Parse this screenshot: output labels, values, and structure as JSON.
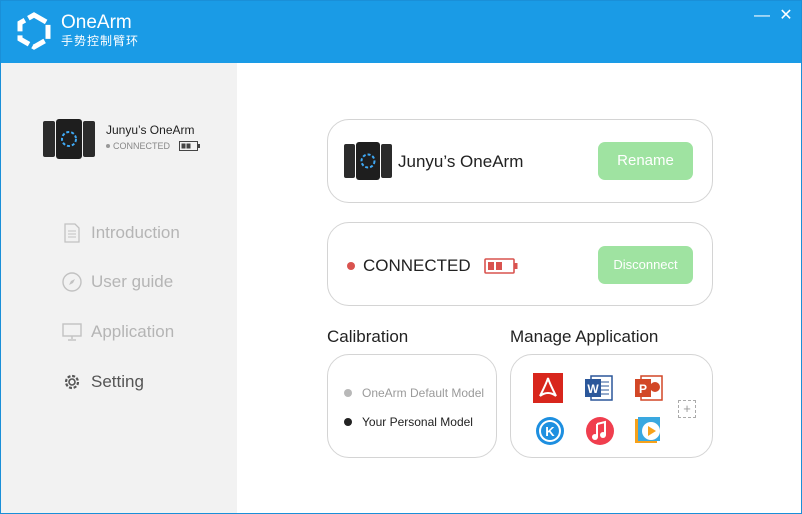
{
  "app": {
    "title": "OneArm",
    "subtitle": "手势控制臂环",
    "accent_color": "#1a9be6"
  },
  "window_controls": {
    "minimize": "—",
    "close": "✕"
  },
  "sidebar": {
    "device_name": "Junyu’s OneArm",
    "device_status": "CONNECTED",
    "items": [
      {
        "label": "Introduction",
        "icon": "document-icon"
      },
      {
        "label": "User guide",
        "icon": "compass-icon"
      },
      {
        "label": "Application",
        "icon": "monitor-icon"
      },
      {
        "label": "Setting",
        "icon": "gear-icon",
        "active": true
      }
    ]
  },
  "device_card": {
    "name": "Junyu’s OneArm",
    "rename_label": "Rename"
  },
  "connection_card": {
    "status": "CONNECTED",
    "status_color": "#d9534f",
    "disconnect_label": "Disconnect"
  },
  "calibration": {
    "title": "Calibration",
    "options": [
      {
        "label": "OneArm Default Model",
        "selected": false
      },
      {
        "label": "Your Personal Model",
        "selected": true
      }
    ]
  },
  "manage_application": {
    "title": "Manage Application",
    "apps": [
      {
        "name": "pdf-reader-icon"
      },
      {
        "name": "word-icon"
      },
      {
        "name": "powerpoint-icon"
      },
      {
        "name": "kugou-music-icon"
      },
      {
        "name": "itunes-icon"
      },
      {
        "name": "media-player-icon"
      }
    ],
    "add_label": "+"
  }
}
